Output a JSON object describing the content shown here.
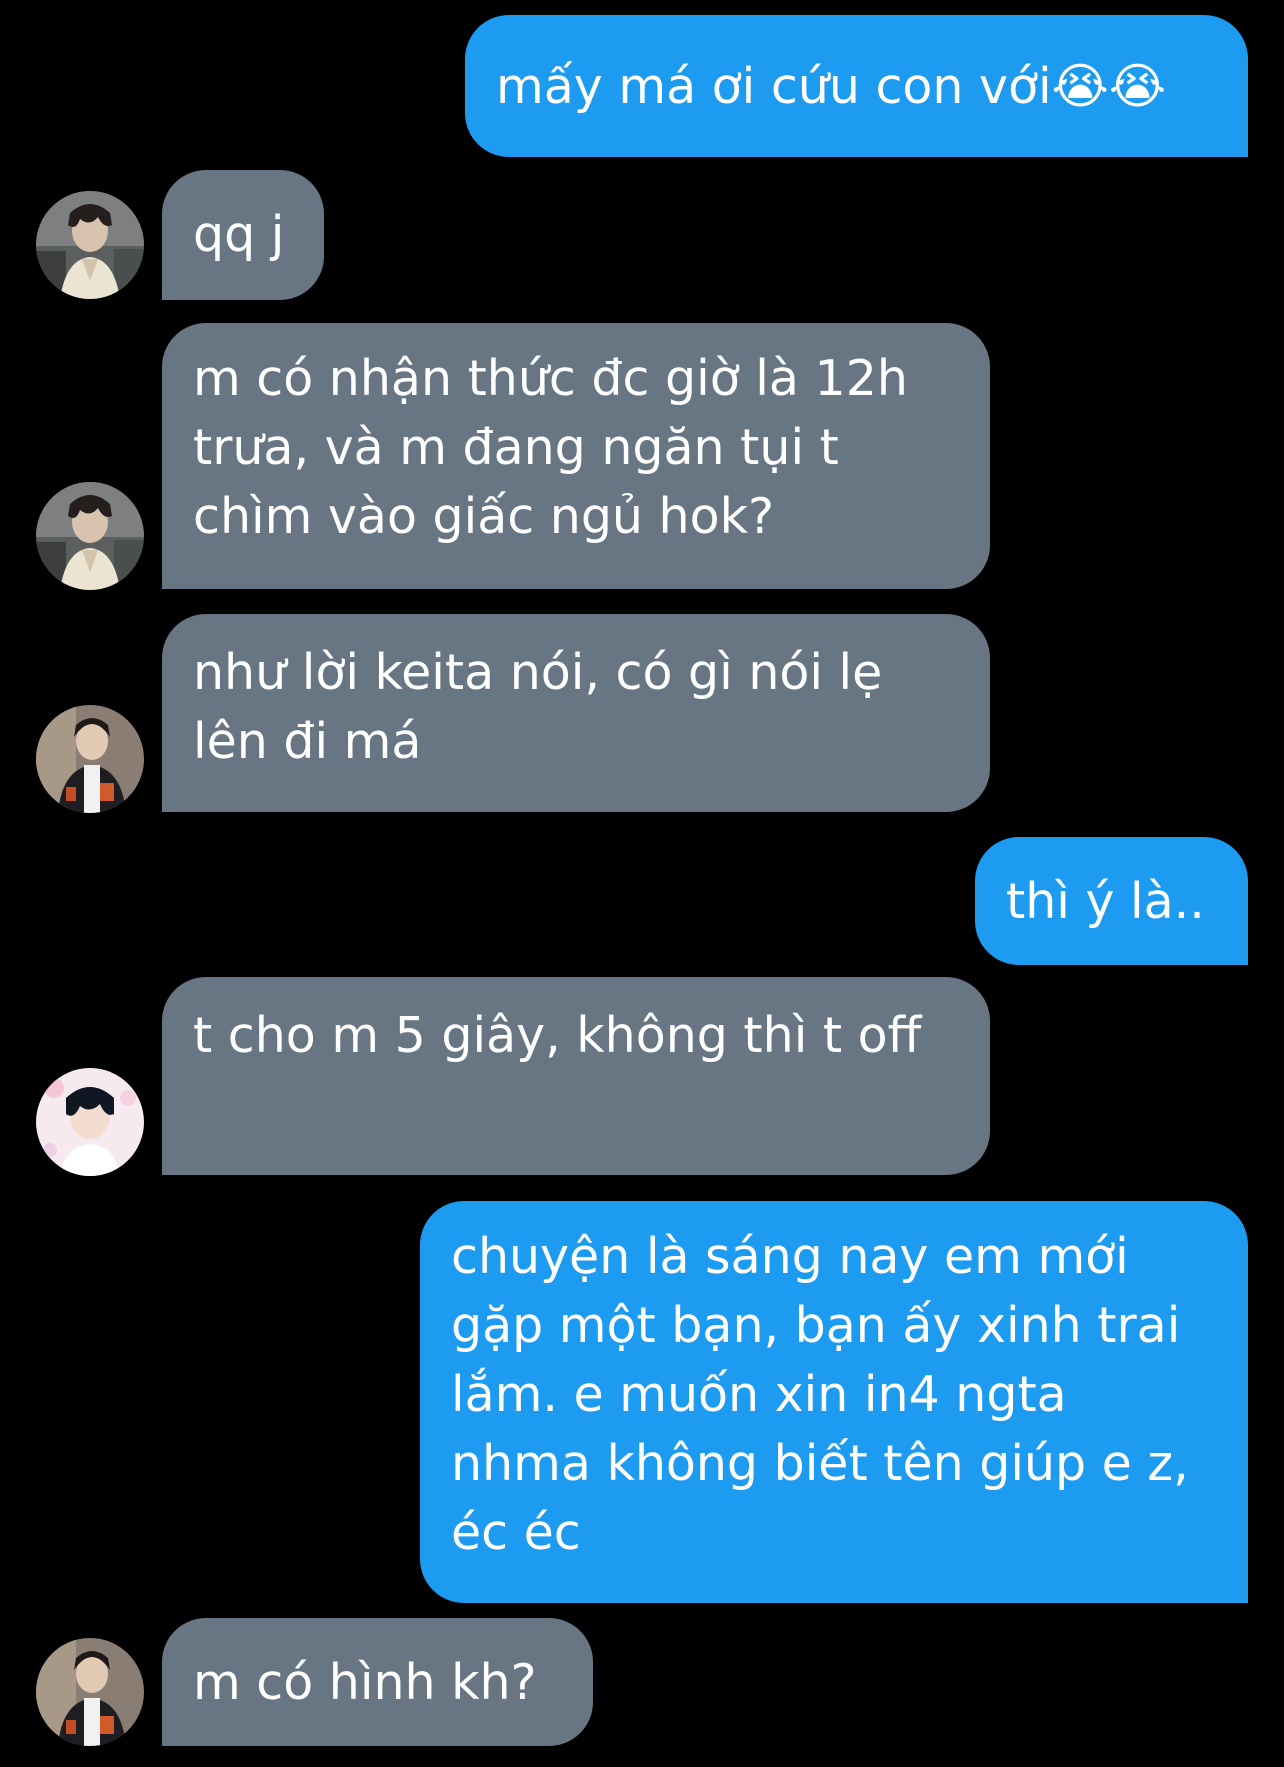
{
  "conversation": {
    "messages": [
      {
        "id": "m1",
        "direction": "sent",
        "text": "mấy má ơi cứu con với😭😭"
      },
      {
        "id": "m2",
        "direction": "received",
        "avatar": "avatar-dark-hair-icon",
        "text": "qq j"
      },
      {
        "id": "m3",
        "direction": "received",
        "avatar": "avatar-dark-hair-icon",
        "text": "m có nhận thức đc giờ là 12h trưa, và m đang ngăn tụi t chìm vào giấc ngủ hok?"
      },
      {
        "id": "m4",
        "direction": "received",
        "avatar": "avatar-jacket-icon",
        "text": "như lời keita nói, có gì nói lẹ lên đi má"
      },
      {
        "id": "m5",
        "direction": "sent",
        "text": "thì ý là.."
      },
      {
        "id": "m6",
        "direction": "received",
        "avatar": "avatar-light-bg-icon",
        "text": "t cho m 5 giây, không thì t off"
      },
      {
        "id": "m7",
        "direction": "sent",
        "text": "chuyện là sáng nay em mới gặp một bạn, bạn ấy xinh trai lắm. e muốn xin in4 ngta nhma không biết tên giúp e z, éc éc"
      },
      {
        "id": "m8",
        "direction": "received",
        "avatar": "avatar-jacket-icon",
        "text": "m có hình kh?"
      }
    ]
  },
  "colors": {
    "background": "#000000",
    "sent_bubble": "#1d9bf0",
    "received_bubble": "#687684",
    "text": "#ffffff"
  }
}
